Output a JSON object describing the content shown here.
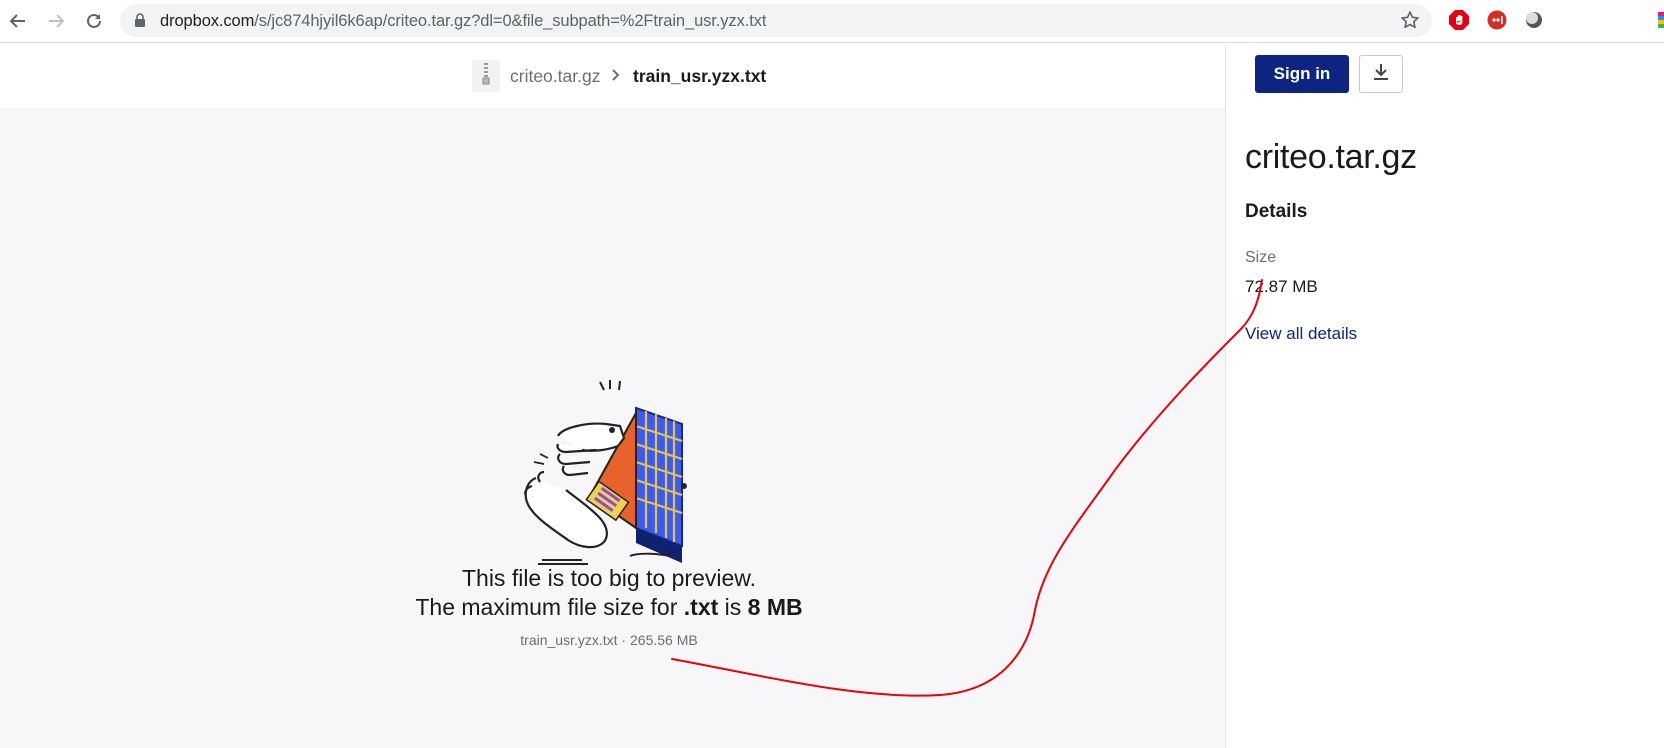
{
  "browser": {
    "url_host": "dropbox.com",
    "url_path": "/s/jc874hjyil6k6ap/criteo.tar.gz?dl=0&file_subpath=%2Ftrain_usr.yzx.txt"
  },
  "breadcrumb": {
    "parent": "criteo.tar.gz",
    "current": "train_usr.yzx.txt"
  },
  "preview": {
    "line1": "This file is too big to preview.",
    "line2_prefix": "The maximum file size for ",
    "line2_ext": ".txt",
    "line2_mid": " is ",
    "line2_max": "8 MB",
    "file_name": "train_usr.yzx.txt",
    "file_sep": " · ",
    "file_size": "265.56 MB"
  },
  "sidebar": {
    "signin_label": "Sign in",
    "title": "criteo.tar.gz",
    "details_heading": "Details",
    "size_label": "Size",
    "size_value": "72.87 MB",
    "view_all_label": "View all details"
  },
  "icons": {
    "back": "back-arrow-icon",
    "forward": "forward-arrow-icon",
    "reload": "reload-icon",
    "lock": "lock-icon",
    "star": "star-icon",
    "download": "download-icon",
    "zip": "zip-file-icon"
  },
  "colors": {
    "signin_bg": "#0d2481",
    "link": "#0d2481",
    "annotation": "#e8000b",
    "preview_bg": "#f7f7f9"
  }
}
